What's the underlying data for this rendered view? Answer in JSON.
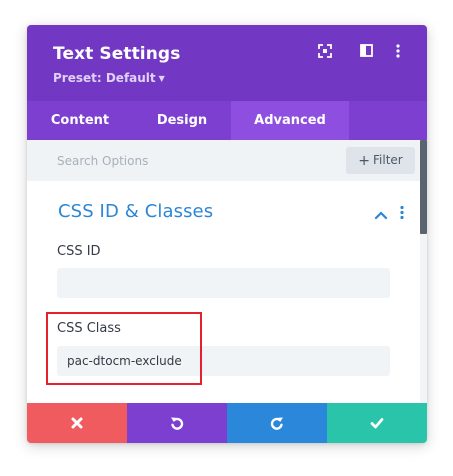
{
  "header": {
    "title": "Text Settings",
    "preset_label": "Preset: Default",
    "icons": [
      "expand-icon",
      "split-layout-icon",
      "more-vertical-icon"
    ]
  },
  "tabs": [
    {
      "label": "Content",
      "active": false
    },
    {
      "label": "Design",
      "active": false
    },
    {
      "label": "Advanced",
      "active": true
    }
  ],
  "search": {
    "placeholder": "Search Options",
    "filter_label": "Filter"
  },
  "section": {
    "title": "CSS ID & Classes",
    "expanded": true
  },
  "fields": {
    "css_id": {
      "label": "CSS ID",
      "value": ""
    },
    "css_class": {
      "label": "CSS Class",
      "value": "pac-dtocm-exclude"
    }
  },
  "footer": {
    "buttons": [
      {
        "name": "cancel",
        "icon": "close-icon",
        "color": "#ef5b5f"
      },
      {
        "name": "undo",
        "icon": "undo-icon",
        "color": "#7c3fd0"
      },
      {
        "name": "redo",
        "icon": "redo-icon",
        "color": "#2b87da"
      },
      {
        "name": "save",
        "icon": "check-icon",
        "color": "#29c4a9"
      }
    ]
  },
  "colors": {
    "header": "#7238c3",
    "tabs": "#7c3fd0",
    "active_tab": "#8e4fe0",
    "section_title": "#2c86d5",
    "highlight_border": "#e6212b"
  }
}
